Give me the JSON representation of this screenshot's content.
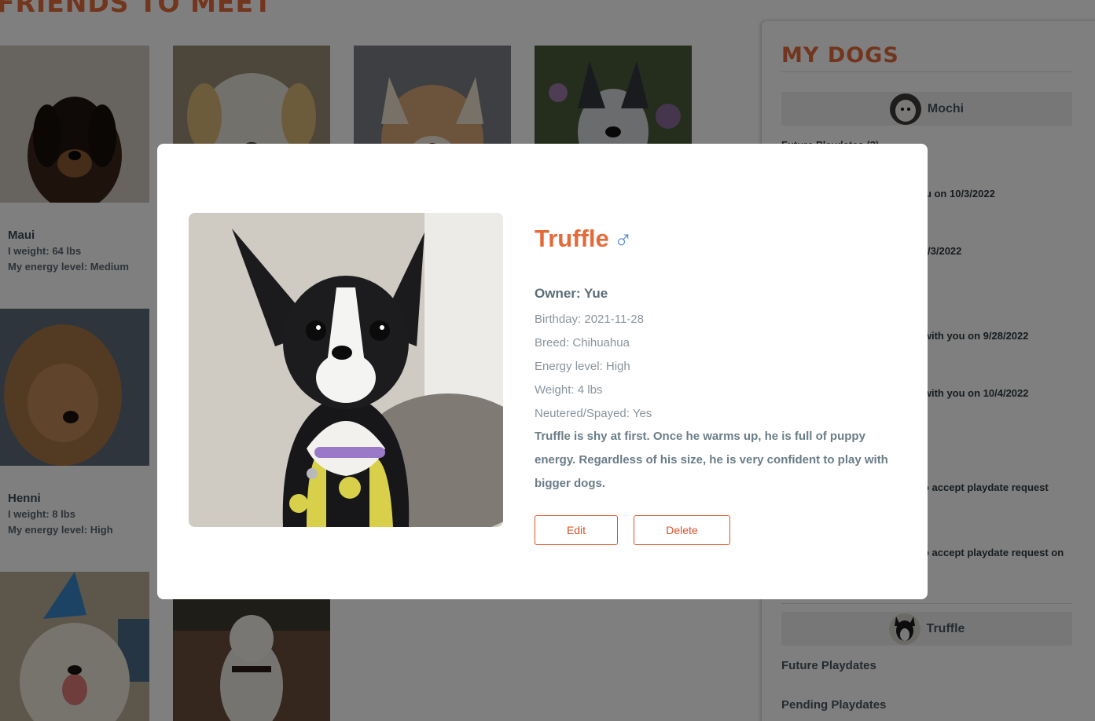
{
  "page": {
    "title": "FRIENDS TO MEET",
    "friends": [
      {
        "name": "Maui",
        "weight": "I weight: 64 lbs",
        "energy": "My energy level: Medium"
      },
      {
        "name": "Henni",
        "weight": "I weight: 8 lbs",
        "energy": "My energy level: High"
      }
    ]
  },
  "sidebar": {
    "title": "MY DOGS",
    "dogs": [
      {
        "name": "Mochi"
      },
      {
        "name": "Truffle",
        "future_label": "Future Playdates",
        "pending_label": "Pending Playdates"
      }
    ],
    "partial_lines": [
      "Future Playdates (3)",
      "ou on 10/3/2022",
      "n 10/3/2022",
      "e with you on 9/28/2022",
      "e with you on 10/4/2022",
      "o accept playdate request",
      "o accept playdate request on"
    ]
  },
  "modal": {
    "name": "Truffle",
    "gender_icon": "male-icon",
    "owner": "Owner: Yue",
    "birthday": "Birthday: 2021-11-28",
    "breed": "Breed: Chihuahua",
    "energy": "Energy level: High",
    "weight": "Weight: 4 lbs",
    "neutered": "Neutered/Spayed: Yes",
    "bio": "Truffle is shy at first. Once he warms up, he is full of puppy energy. Regardless of his size, he is very confident to play with bigger dogs.",
    "edit_label": "Edit",
    "delete_label": "Delete"
  },
  "colors": {
    "accent": "#e46a3a",
    "button": "#d9532b",
    "gender": "#4f86d6"
  }
}
